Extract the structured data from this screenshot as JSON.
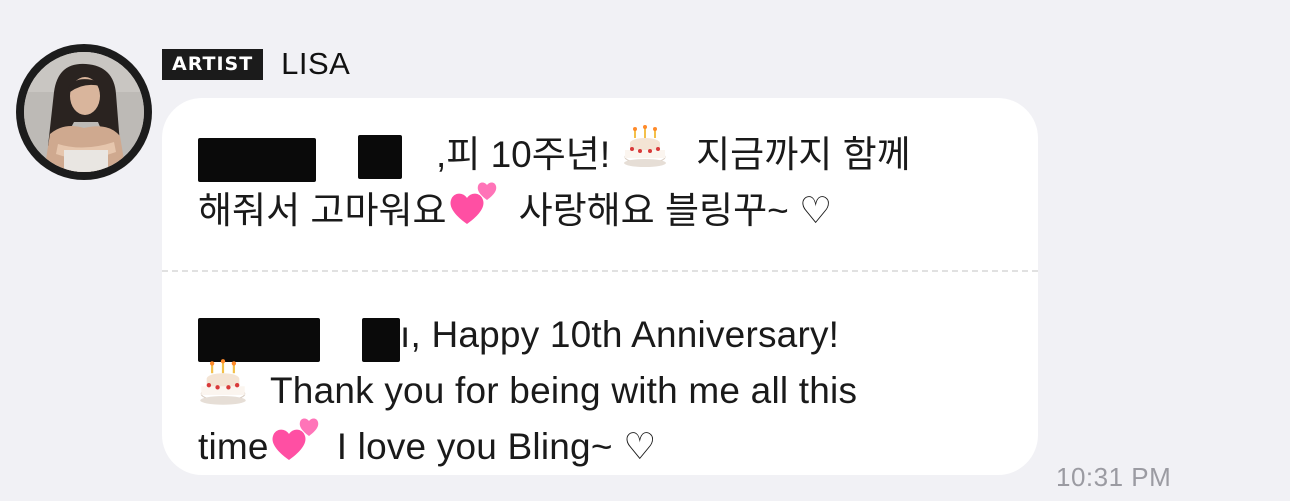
{
  "sender": {
    "badge": "ARTIST",
    "name": "LISA"
  },
  "message": {
    "korean_lines": [
      ",피 10주년!",
      "지금까지 함께",
      "해줘서 고마워요",
      "사랑해요 블링꾸~ ♡"
    ],
    "english_lines": [
      "ı, Happy 10th Anniversary!",
      "Thank you for being with me all this",
      "time",
      "I love you Bling~ ♡"
    ],
    "timestamp": "10:31 PM"
  },
  "icons": [
    "cake-emoji-icon",
    "two-hearts-emoji-icon"
  ],
  "colors": {
    "background": "#f1f1f5",
    "bubble": "#ffffff",
    "badge": "#1b1b1b",
    "timestamp": "#9b9ba2",
    "heart": "#ff4fa3"
  }
}
